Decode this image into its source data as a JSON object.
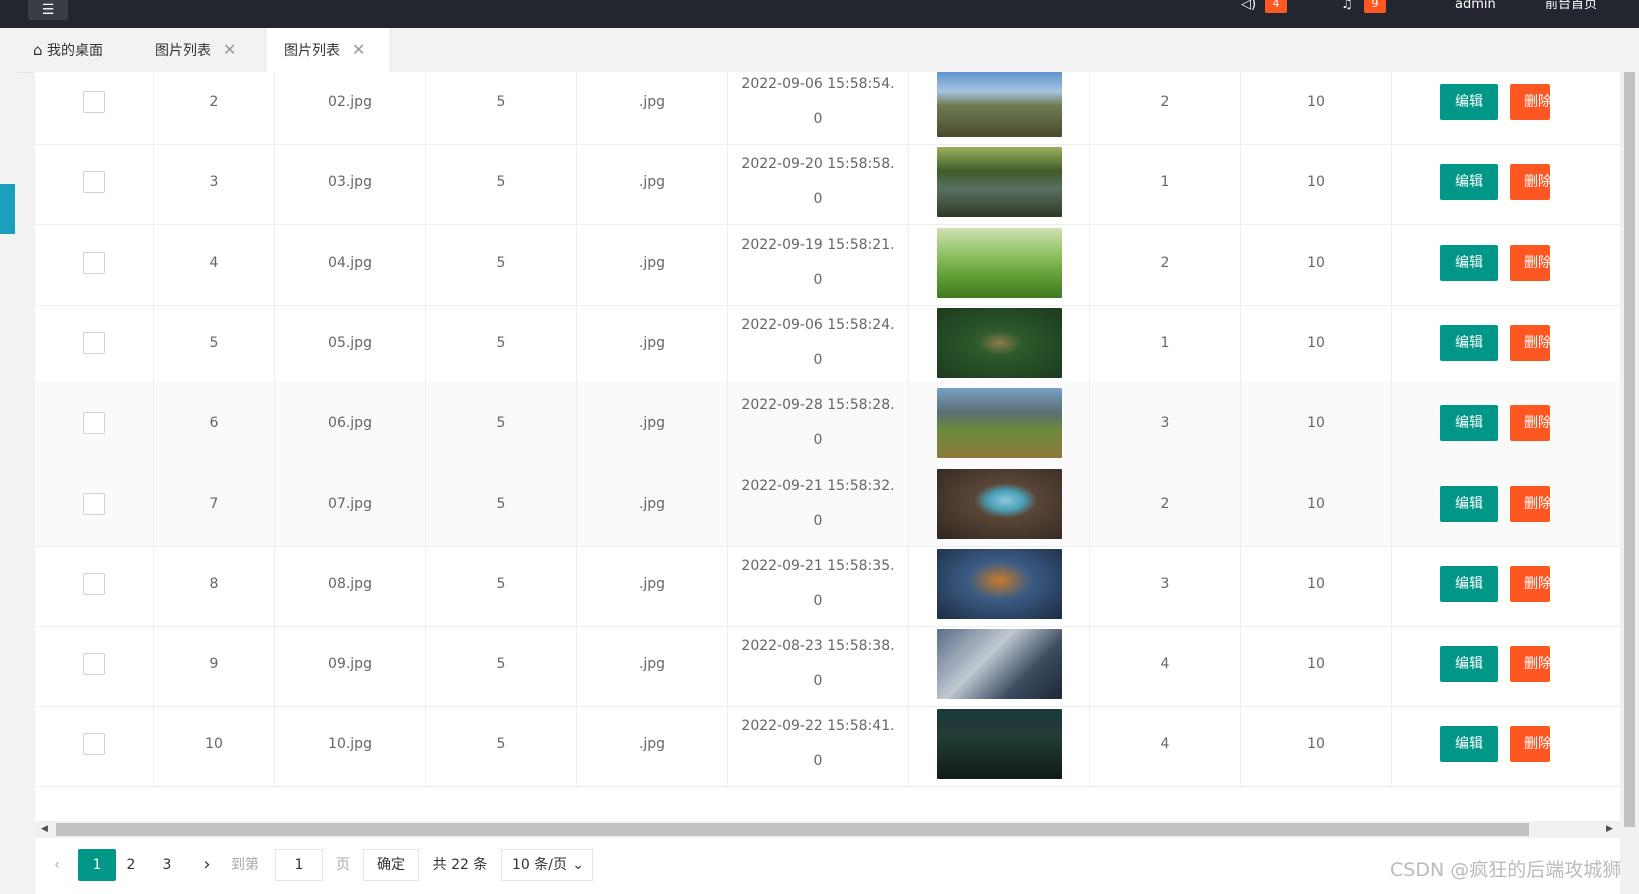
{
  "header": {
    "menu_icon": "menu-icon",
    "announcement_count": "4",
    "notification_count": "9",
    "user": "admin",
    "front_link": "前台首页"
  },
  "tabs": [
    {
      "label": "我的桌面",
      "icon": "home-icon",
      "closable": false,
      "active": false
    },
    {
      "label": "图片列表",
      "closable": true,
      "active": false
    },
    {
      "label": "图片列表",
      "closable": true,
      "active": true
    }
  ],
  "table": {
    "rows": [
      {
        "id": "2",
        "name": "02.jpg",
        "c3": "5",
        "ext": ".jpg",
        "date": "2022-09-06 15:58:54.",
        "date_frac": "0",
        "thumb": "mountain-sky",
        "c8": "2",
        "c9": "10"
      },
      {
        "id": "3",
        "name": "03.jpg",
        "c3": "5",
        "ext": ".jpg",
        "date": "2022-09-20 15:58:58.",
        "date_frac": "0",
        "thumb": "forest-lake",
        "c8": "1",
        "c9": "10"
      },
      {
        "id": "4",
        "name": "04.jpg",
        "c3": "5",
        "ext": ".jpg",
        "date": "2022-09-19 15:58:21.",
        "date_frac": "0",
        "thumb": "green-hills",
        "c8": "2",
        "c9": "10"
      },
      {
        "id": "5",
        "name": "05.jpg",
        "c3": "5",
        "ext": ".jpg",
        "date": "2022-09-06 15:58:24.",
        "date_frac": "0",
        "thumb": "river-forest",
        "c8": "1",
        "c9": "10"
      },
      {
        "id": "6",
        "name": "06.jpg",
        "c3": "5",
        "ext": ".jpg",
        "date": "2022-09-28 15:58:28.",
        "date_frac": "0",
        "thumb": "alpine-meadow",
        "c8": "3",
        "c9": "10"
      },
      {
        "id": "7",
        "name": "07.jpg",
        "c3": "5",
        "ext": ".jpg",
        "date": "2022-09-21 15:58:32.",
        "date_frac": "0",
        "thumb": "sea-cave",
        "c8": "2",
        "c9": "10"
      },
      {
        "id": "8",
        "name": "08.jpg",
        "c3": "5",
        "ext": ".jpg",
        "date": "2022-09-21 15:58:35.",
        "date_frac": "0",
        "thumb": "robot-poster",
        "c8": "3",
        "c9": "10"
      },
      {
        "id": "9",
        "name": "09.jpg",
        "c3": "5",
        "ext": ".jpg",
        "date": "2022-08-23 15:58:38.",
        "date_frac": "0",
        "thumb": "mech-battle",
        "c8": "4",
        "c9": "10"
      },
      {
        "id": "10",
        "name": "10.jpg",
        "c3": "5",
        "ext": ".jpg",
        "date": "2022-09-22 15:58:41.",
        "date_frac": "0",
        "thumb": "group-poster",
        "c8": "4",
        "c9": "10"
      }
    ],
    "edit_label": "编辑",
    "delete_label": "删除"
  },
  "pagination": {
    "pages": [
      "1",
      "2",
      "3"
    ],
    "current": "1",
    "goto_label": "到第",
    "goto_value": "1",
    "page_unit": "页",
    "confirm_label": "确定",
    "total_label": "共 22 条",
    "page_size": "10 条/页"
  },
  "watermark": "CSDN @疯狂的后端攻城狮",
  "colors": {
    "accent": "#009688",
    "danger": "#ff5722",
    "topbar": "#23262e"
  }
}
